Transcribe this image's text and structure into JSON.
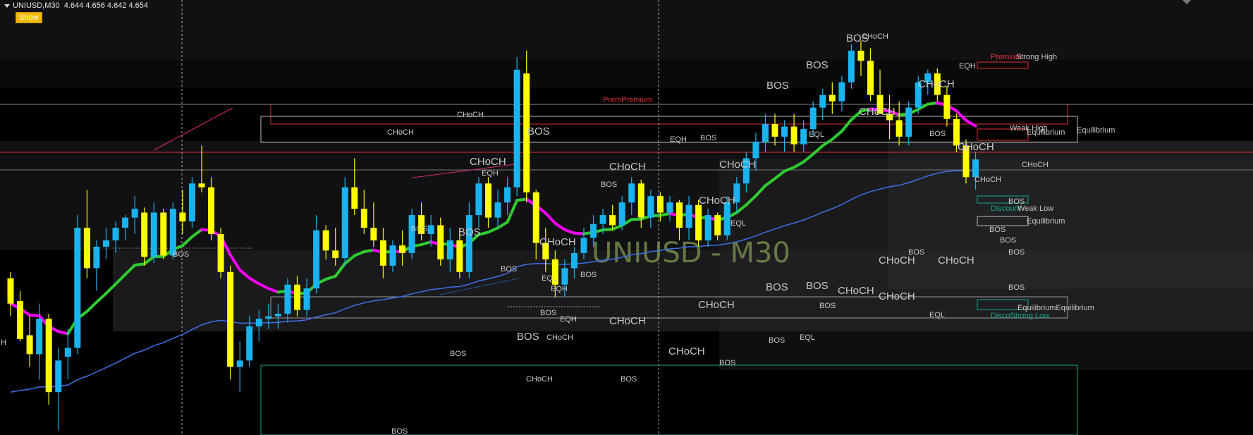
{
  "header": {
    "symbol": "UNIUSD,M30",
    "ohlc": "4.644 4.656 4.642 4.654",
    "show_label": "Show"
  },
  "watermark": "UNIUSD - M30",
  "left_edge_label": "H",
  "colors": {
    "background": "#000000",
    "band_dark": "#111113",
    "band_light": "#1a1a1c",
    "bull": "#19b4f0",
    "bear": "#ffff00",
    "ema_up": "#2ecc30",
    "ema_down": "#ff00ff",
    "ma_slow": "#3f6fe8",
    "label": "#c8c8c8",
    "premium": "#e0303a",
    "discount": "#17a58a",
    "equilibrium_box": "#b8b8b8"
  },
  "candles": [
    {
      "o": 4.56,
      "h": 4.565,
      "l": 4.53,
      "c": 4.54
    },
    {
      "o": 4.542,
      "h": 4.55,
      "l": 4.51,
      "c": 4.512
    },
    {
      "o": 4.515,
      "h": 4.53,
      "l": 4.49,
      "c": 4.5
    },
    {
      "o": 4.5,
      "h": 4.54,
      "l": 4.48,
      "c": 4.528
    },
    {
      "o": 4.528,
      "h": 4.532,
      "l": 4.46,
      "c": 4.47
    },
    {
      "o": 4.47,
      "h": 4.505,
      "l": 4.44,
      "c": 4.495
    },
    {
      "o": 4.498,
      "h": 4.52,
      "l": 4.48,
      "c": 4.505
    },
    {
      "o": 4.505,
      "h": 4.61,
      "l": 4.5,
      "c": 4.6
    },
    {
      "o": 4.6,
      "h": 4.63,
      "l": 4.56,
      "c": 4.568
    },
    {
      "o": 4.568,
      "h": 4.59,
      "l": 4.55,
      "c": 4.585
    },
    {
      "o": 4.585,
      "h": 4.6,
      "l": 4.575,
      "c": 4.59
    },
    {
      "o": 4.59,
      "h": 4.605,
      "l": 4.58,
      "c": 4.6
    },
    {
      "o": 4.6,
      "h": 4.61,
      "l": 4.59,
      "c": 4.608
    },
    {
      "o": 4.608,
      "h": 4.625,
      "l": 4.595,
      "c": 4.615
    },
    {
      "o": 4.612,
      "h": 4.616,
      "l": 4.57,
      "c": 4.577
    },
    {
      "o": 4.577,
      "h": 4.62,
      "l": 4.572,
      "c": 4.612
    },
    {
      "o": 4.612,
      "h": 4.615,
      "l": 4.575,
      "c": 4.578
    },
    {
      "o": 4.578,
      "h": 4.62,
      "l": 4.575,
      "c": 4.615
    },
    {
      "o": 4.612,
      "h": 4.63,
      "l": 4.595,
      "c": 4.605
    },
    {
      "o": 4.605,
      "h": 4.64,
      "l": 4.6,
      "c": 4.635
    },
    {
      "o": 4.635,
      "h": 4.665,
      "l": 4.628,
      "c": 4.632
    },
    {
      "o": 4.632,
      "h": 4.64,
      "l": 4.59,
      "c": 4.595
    },
    {
      "o": 4.595,
      "h": 4.6,
      "l": 4.56,
      "c": 4.565
    },
    {
      "o": 4.565,
      "h": 4.57,
      "l": 4.48,
      "c": 4.49
    },
    {
      "o": 4.49,
      "h": 4.51,
      "l": 4.47,
      "c": 4.495
    },
    {
      "o": 4.495,
      "h": 4.53,
      "l": 4.49,
      "c": 4.522
    },
    {
      "o": 4.522,
      "h": 4.535,
      "l": 4.51,
      "c": 4.528
    },
    {
      "o": 4.528,
      "h": 4.54,
      "l": 4.52,
      "c": 4.53
    },
    {
      "o": 4.53,
      "h": 4.54,
      "l": 4.52,
      "c": 4.532
    },
    {
      "o": 4.532,
      "h": 4.56,
      "l": 4.525,
      "c": 4.555
    },
    {
      "o": 4.555,
      "h": 4.562,
      "l": 4.53,
      "c": 4.535
    },
    {
      "o": 4.535,
      "h": 4.56,
      "l": 4.53,
      "c": 4.552
    },
    {
      "o": 4.552,
      "h": 4.61,
      "l": 4.548,
      "c": 4.598
    },
    {
      "o": 4.598,
      "h": 4.602,
      "l": 4.575,
      "c": 4.582
    },
    {
      "o": 4.582,
      "h": 4.6,
      "l": 4.57,
      "c": 4.576
    },
    {
      "o": 4.576,
      "h": 4.64,
      "l": 4.57,
      "c": 4.632
    },
    {
      "o": 4.632,
      "h": 4.655,
      "l": 4.61,
      "c": 4.615
    },
    {
      "o": 4.615,
      "h": 4.63,
      "l": 4.595,
      "c": 4.6
    },
    {
      "o": 4.6,
      "h": 4.62,
      "l": 4.585,
      "c": 4.59
    },
    {
      "o": 4.59,
      "h": 4.6,
      "l": 4.56,
      "c": 4.57
    },
    {
      "o": 4.57,
      "h": 4.59,
      "l": 4.565,
      "c": 4.586
    },
    {
      "o": 4.586,
      "h": 4.598,
      "l": 4.57,
      "c": 4.58
    },
    {
      "o": 4.58,
      "h": 4.615,
      "l": 4.575,
      "c": 4.61
    },
    {
      "o": 4.61,
      "h": 4.62,
      "l": 4.59,
      "c": 4.595
    },
    {
      "o": 4.595,
      "h": 4.61,
      "l": 4.585,
      "c": 4.602
    },
    {
      "o": 4.602,
      "h": 4.608,
      "l": 4.57,
      "c": 4.575
    },
    {
      "o": 4.575,
      "h": 4.6,
      "l": 4.565,
      "c": 4.59
    },
    {
      "o": 4.59,
      "h": 4.6,
      "l": 4.56,
      "c": 4.565
    },
    {
      "o": 4.565,
      "h": 4.62,
      "l": 4.56,
      "c": 4.61
    },
    {
      "o": 4.61,
      "h": 4.64,
      "l": 4.6,
      "c": 4.635
    },
    {
      "o": 4.635,
      "h": 4.64,
      "l": 4.6,
      "c": 4.608
    },
    {
      "o": 4.608,
      "h": 4.63,
      "l": 4.6,
      "c": 4.62
    },
    {
      "o": 4.62,
      "h": 4.64,
      "l": 4.61,
      "c": 4.632
    },
    {
      "o": 4.632,
      "h": 4.735,
      "l": 4.625,
      "c": 4.725
    },
    {
      "o": 4.722,
      "h": 4.74,
      "l": 4.62,
      "c": 4.628
    },
    {
      "o": 4.628,
      "h": 4.63,
      "l": 4.575,
      "c": 4.588
    },
    {
      "o": 4.588,
      "h": 4.6,
      "l": 4.565,
      "c": 4.575
    },
    {
      "o": 4.575,
      "h": 4.582,
      "l": 4.545,
      "c": 4.555
    },
    {
      "o": 4.555,
      "h": 4.575,
      "l": 4.545,
      "c": 4.568
    },
    {
      "o": 4.568,
      "h": 4.585,
      "l": 4.56,
      "c": 4.58
    },
    {
      "o": 4.58,
      "h": 4.6,
      "l": 4.575,
      "c": 4.592
    },
    {
      "o": 4.592,
      "h": 4.61,
      "l": 4.585,
      "c": 4.603
    },
    {
      "o": 4.603,
      "h": 4.615,
      "l": 4.595,
      "c": 4.61
    },
    {
      "o": 4.61,
      "h": 4.618,
      "l": 4.598,
      "c": 4.602
    },
    {
      "o": 4.602,
      "h": 4.625,
      "l": 4.598,
      "c": 4.62
    },
    {
      "o": 4.62,
      "h": 4.64,
      "l": 4.61,
      "c": 4.635
    },
    {
      "o": 4.635,
      "h": 4.638,
      "l": 4.6,
      "c": 4.608
    },
    {
      "o": 4.608,
      "h": 4.63,
      "l": 4.6,
      "c": 4.625
    },
    {
      "o": 4.625,
      "h": 4.628,
      "l": 4.605,
      "c": 4.612
    },
    {
      "o": 4.612,
      "h": 4.625,
      "l": 4.605,
      "c": 4.62
    },
    {
      "o": 4.62,
      "h": 4.622,
      "l": 4.59,
      "c": 4.6
    },
    {
      "o": 4.6,
      "h": 4.625,
      "l": 4.59,
      "c": 4.618
    },
    {
      "o": 4.618,
      "h": 4.622,
      "l": 4.585,
      "c": 4.59
    },
    {
      "o": 4.59,
      "h": 4.615,
      "l": 4.585,
      "c": 4.61
    },
    {
      "o": 4.61,
      "h": 4.612,
      "l": 4.59,
      "c": 4.594
    },
    {
      "o": 4.594,
      "h": 4.625,
      "l": 4.59,
      "c": 4.62
    },
    {
      "o": 4.62,
      "h": 4.64,
      "l": 4.612,
      "c": 4.635
    },
    {
      "o": 4.635,
      "h": 4.66,
      "l": 4.628,
      "c": 4.655
    },
    {
      "o": 4.655,
      "h": 4.675,
      "l": 4.645,
      "c": 4.668
    },
    {
      "o": 4.668,
      "h": 4.69,
      "l": 4.66,
      "c": 4.682
    },
    {
      "o": 4.682,
      "h": 4.69,
      "l": 4.665,
      "c": 4.672
    },
    {
      "o": 4.672,
      "h": 4.685,
      "l": 4.66,
      "c": 4.68
    },
    {
      "o": 4.68,
      "h": 4.69,
      "l": 4.66,
      "c": 4.666
    },
    {
      "o": 4.666,
      "h": 4.685,
      "l": 4.66,
      "c": 4.678
    },
    {
      "o": 4.678,
      "h": 4.7,
      "l": 4.672,
      "c": 4.695
    },
    {
      "o": 4.695,
      "h": 4.71,
      "l": 4.685,
      "c": 4.705
    },
    {
      "o": 4.705,
      "h": 4.715,
      "l": 4.69,
      "c": 4.7
    },
    {
      "o": 4.7,
      "h": 4.72,
      "l": 4.692,
      "c": 4.715
    },
    {
      "o": 4.715,
      "h": 4.745,
      "l": 4.71,
      "c": 4.74
    },
    {
      "o": 4.74,
      "h": 4.748,
      "l": 4.72,
      "c": 4.732
    },
    {
      "o": 4.732,
      "h": 4.742,
      "l": 4.7,
      "c": 4.705
    },
    {
      "o": 4.705,
      "h": 4.725,
      "l": 4.69,
      "c": 4.69
    },
    {
      "o": 4.69,
      "h": 4.705,
      "l": 4.67,
      "c": 4.685
    },
    {
      "o": 4.685,
      "h": 4.7,
      "l": 4.665,
      "c": 4.672
    },
    {
      "o": 4.672,
      "h": 4.7,
      "l": 4.665,
      "c": 4.695
    },
    {
      "o": 4.695,
      "h": 4.72,
      "l": 4.69,
      "c": 4.715
    },
    {
      "o": 4.715,
      "h": 4.725,
      "l": 4.705,
      "c": 4.722
    },
    {
      "o": 4.722,
      "h": 4.726,
      "l": 4.7,
      "c": 4.705
    },
    {
      "o": 4.705,
      "h": 4.712,
      "l": 4.68,
      "c": 4.686
    },
    {
      "o": 4.686,
      "h": 4.69,
      "l": 4.66,
      "c": 4.665
    },
    {
      "o": 4.665,
      "h": 4.67,
      "l": 4.635,
      "c": 4.64
    },
    {
      "o": 4.64,
      "h": 4.66,
      "l": 4.63,
      "c": 4.654
    }
  ],
  "labels": {
    "bos": "BOS",
    "choch": "CHoCH",
    "eqh": "EQH",
    "eql": "EQL",
    "premium": "Premium",
    "premium_dup": "PremPremium",
    "strong_high": "Strong High",
    "weak_high": "Weak High",
    "equilibrium": "Equilibrium",
    "equilibrium_dup": "EquilibriumEquilibrium",
    "weak_low": "Weak Low",
    "strong_low": "Strong Low",
    "discount": "Discount",
    "discount_dup": "DiscoStrong Low"
  }
}
